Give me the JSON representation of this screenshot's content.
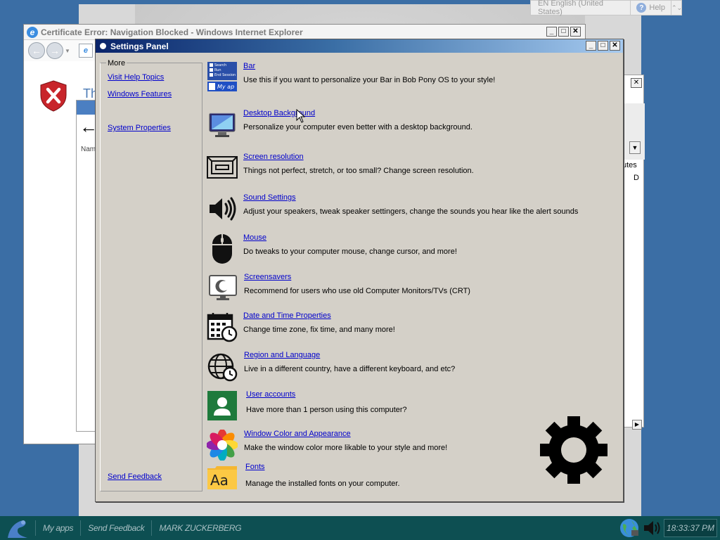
{
  "langbar": {
    "language": "EN English (United States)",
    "help": "Help",
    "options": "⌃⌄"
  },
  "ie": {
    "title": "Certificate Error: Navigation Blocked - Windows Internet Explorer",
    "heading_fragment": "Th"
  },
  "explorer": {
    "column_fragment": "Nam"
  },
  "right_window": {
    "column_fragment": "utes",
    "cell_fragment": "D"
  },
  "settings": {
    "title": "Settings Panel",
    "sidebar": {
      "group": "More",
      "links": [
        "Visit Help Topics",
        "Windows Features",
        "System Properties"
      ],
      "feedback": "Send Feedback"
    },
    "items": [
      {
        "label": "Bar",
        "desc": "Use this if you want to personalize your Bar in Bob Pony OS to your style!",
        "icon": "bar-icon"
      },
      {
        "label": "Desktop Background",
        "desc": "Personalize your computer even better with a desktop background.",
        "icon": "monitor-icon"
      },
      {
        "label": "Screen resolution",
        "desc": "Things not perfect, stretch, or too small? Change screen resolution.",
        "icon": "resolution-icon"
      },
      {
        "label": "Sound Settings",
        "desc": "Adjust your speakers, tweak speaker settingers, change the sounds you hear like the alert sounds",
        "icon": "speaker-icon"
      },
      {
        "label": "Mouse",
        "desc": "Do tweaks to your computer mouse, change cursor, and more!",
        "icon": "mouse-icon"
      },
      {
        "label": "Screensavers",
        "desc": "Recommend for users who use old Computer Monitors/TVs (CRT)",
        "icon": "screensaver-icon"
      },
      {
        "label": "Date and Time Properties",
        "desc": "Change time zone, fix time, and many more!",
        "icon": "calendar-clock-icon"
      },
      {
        "label": "Region and Language",
        "desc": "Live in a different country, have a different keyboard, and etc?",
        "icon": "globe-icon"
      },
      {
        "label": "User accounts",
        "desc": "Have more than 1 person using this computer?",
        "icon": "user-icon"
      },
      {
        "label": "Window Color and Appearance",
        "desc": "Make the window color more likable to your style and more!",
        "icon": "color-wheel-icon"
      },
      {
        "label": "Fonts",
        "desc": "Manage the installed fonts on your computer.",
        "icon": "fonts-icon"
      }
    ],
    "bar_icon_text": [
      "Search",
      "Run",
      "End Session",
      "My ap"
    ],
    "fonts_icon_text": "Aa"
  },
  "taskbar": {
    "items": [
      "My apps",
      "Send Feedback",
      "MARK ZUCKERBERG"
    ],
    "clock": "18:33:37 PM"
  },
  "colors": {
    "desktop": "#3b6ea5",
    "taskbar": "#0d4f52",
    "titlebar_start": "#0a246a",
    "titlebar_end": "#a6caf0",
    "link": "#0000cc",
    "user_tile": "#1e7a3c"
  }
}
